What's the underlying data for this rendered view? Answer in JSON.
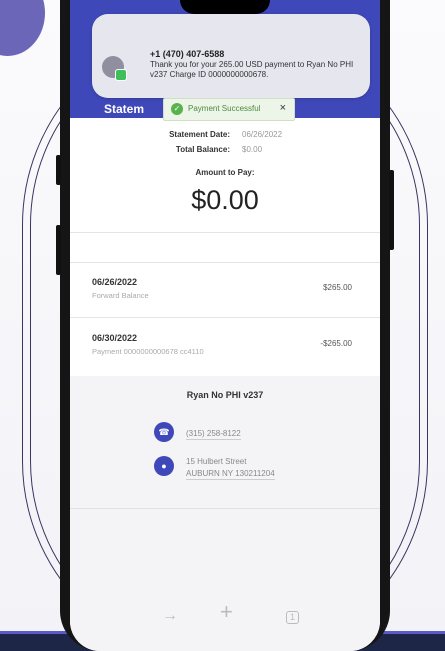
{
  "notification": {
    "sender": "+1 (470) 407-6588",
    "message": "Thank you for your 265.00 USD payment to Ryan No PHI v237 Charge ID 0000000000678."
  },
  "header": {
    "title": "Statem"
  },
  "toast": {
    "message": "Payment Successful",
    "close_glyph": "×",
    "check_glyph": "✓"
  },
  "summary": {
    "statement_date_label": "Statement Date:",
    "statement_date_value": "06/26/2022",
    "total_balance_label": "Total Balance:",
    "total_balance_value": "$0.00",
    "amount_to_pay_label": "Amount to Pay:",
    "amount_to_pay_value": "$0.00"
  },
  "ledger": [
    {
      "date": "06/26/2022",
      "description": "Forward Balance",
      "amount": "$265.00"
    },
    {
      "date": "06/30/2022",
      "description": "Payment 0000000000678 cc4110",
      "amount": "-$265.00"
    }
  ],
  "merchant": {
    "name": "Ryan No PHI v237",
    "phone": "(315) 258-8122",
    "address_line1": "15 Hulbert Street",
    "address_line2": "AUBURN NY 130211204"
  },
  "icons": {
    "phone": "phone-icon",
    "location": "location-icon"
  },
  "bottom_nav": {
    "back_glyph": "→",
    "add_glyph": "+",
    "tabs_glyph": "1"
  },
  "colors": {
    "header": "#3f48b9",
    "toast_bg": "#edf4e8",
    "toast_text": "#4c8a40",
    "accent_icon": "#3f48b9"
  }
}
